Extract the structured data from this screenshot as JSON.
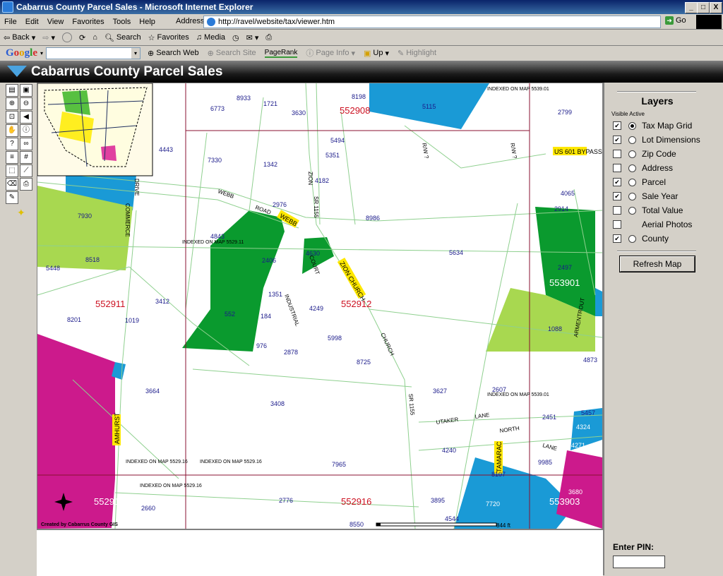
{
  "window": {
    "title": "Cabarrus County Parcel Sales - Microsoft Internet Explorer",
    "minimize": "_",
    "maximize": "□",
    "close": "X"
  },
  "menu": [
    "File",
    "Edit",
    "View",
    "Favorites",
    "Tools",
    "Help"
  ],
  "address": {
    "label": "Address",
    "url": "http://ravel/website/tax/viewer.htm",
    "go": "Go"
  },
  "toolbar": {
    "back": "Back",
    "search": "Search",
    "favorites": "Favorites",
    "media": "Media"
  },
  "google": {
    "logo": "Google",
    "search_web": "Search Web",
    "search_site": "Search Site",
    "pagerank": "PageRank",
    "page_info": "Page Info",
    "up": "Up",
    "highlight": "Highlight"
  },
  "banner": {
    "title": "Cabarrus County Parcel Sales"
  },
  "layers": {
    "title": "Layers",
    "visible_active": "Visible Active",
    "items": [
      {
        "label": "Tax Map Grid",
        "checked": true,
        "radio": "on"
      },
      {
        "label": "Lot Dimensions",
        "checked": true,
        "radio": "off"
      },
      {
        "label": "Zip Code",
        "checked": false,
        "radio": "off"
      },
      {
        "label": "Address",
        "checked": false,
        "radio": "off"
      },
      {
        "label": "Parcel",
        "checked": true,
        "radio": "off"
      },
      {
        "label": "Sale Year",
        "checked": true,
        "radio": "off"
      },
      {
        "label": "Total Value",
        "checked": false,
        "radio": "off"
      },
      {
        "label": "Aerial Photos",
        "checked": false,
        "radio": "none"
      },
      {
        "label": "County",
        "checked": true,
        "radio": "off"
      }
    ],
    "refresh": "Refresh Map"
  },
  "pin": {
    "label": "Enter PIN:"
  },
  "map": {
    "grid_labels": [
      "552908",
      "552911",
      "552912",
      "553901",
      "552915",
      "552916",
      "553903"
    ],
    "indexed_labels": [
      "INDEXED ON MAP 5539.01",
      "INDEXED ON MAP 5529.11",
      "INDEXED ON MAP 5539.01",
      "INDEXED ON MAP 5529.16",
      "INDEXED ON MAP 5529.16",
      "INDEXED ON MAP 5529.16"
    ],
    "streets": [
      "US 601 BYPASS",
      "WEBB",
      "ZION CHURCH",
      "AMHURST",
      "TAMARAC",
      "WEBB",
      "ROAD",
      "ZION",
      "SR 1155",
      "CHURCH",
      "SR 1155",
      "COMMERCE",
      "DRIVE",
      "INDUSTRIAL",
      "COURT",
      "UTAKER",
      "LANE",
      "NORTH",
      "LANE",
      "ARMENTROUT",
      "R/W ?",
      "R/W ?"
    ],
    "parcels": [
      "8933",
      "1721",
      "3630",
      "8198",
      "5115",
      "2799",
      "6773",
      "5494",
      "5351",
      "4443",
      "7330",
      "1342",
      "4182",
      "2976",
      "8986",
      "4065",
      "2914",
      "7930",
      "4843",
      "2406",
      "4630",
      "5634",
      "2497",
      "8518",
      "5448",
      "1351",
      "3412",
      "4249",
      "1088",
      "552",
      "184",
      "976",
      "2878",
      "5998",
      "8201",
      "1019",
      "8725",
      "4873",
      "3664",
      "3627",
      "2607",
      "3408",
      "2451",
      "5457",
      "4324",
      "4240",
      "7965",
      "9985",
      "4271",
      "8107",
      "3895",
      "7720",
      "3680",
      "2660",
      "2776",
      "4544",
      "8550"
    ],
    "credit": "Created by Cabarrus County GIS",
    "scale": "844 ft"
  },
  "colors": {
    "dark_green": "#0a9a2e",
    "light_green": "#a8d850",
    "blue": "#1a9ad6",
    "magenta": "#cc1a8c",
    "grid_line": "#8a1030",
    "parcel_line": "#8fd08f",
    "label_yellow": "#ffe800"
  }
}
